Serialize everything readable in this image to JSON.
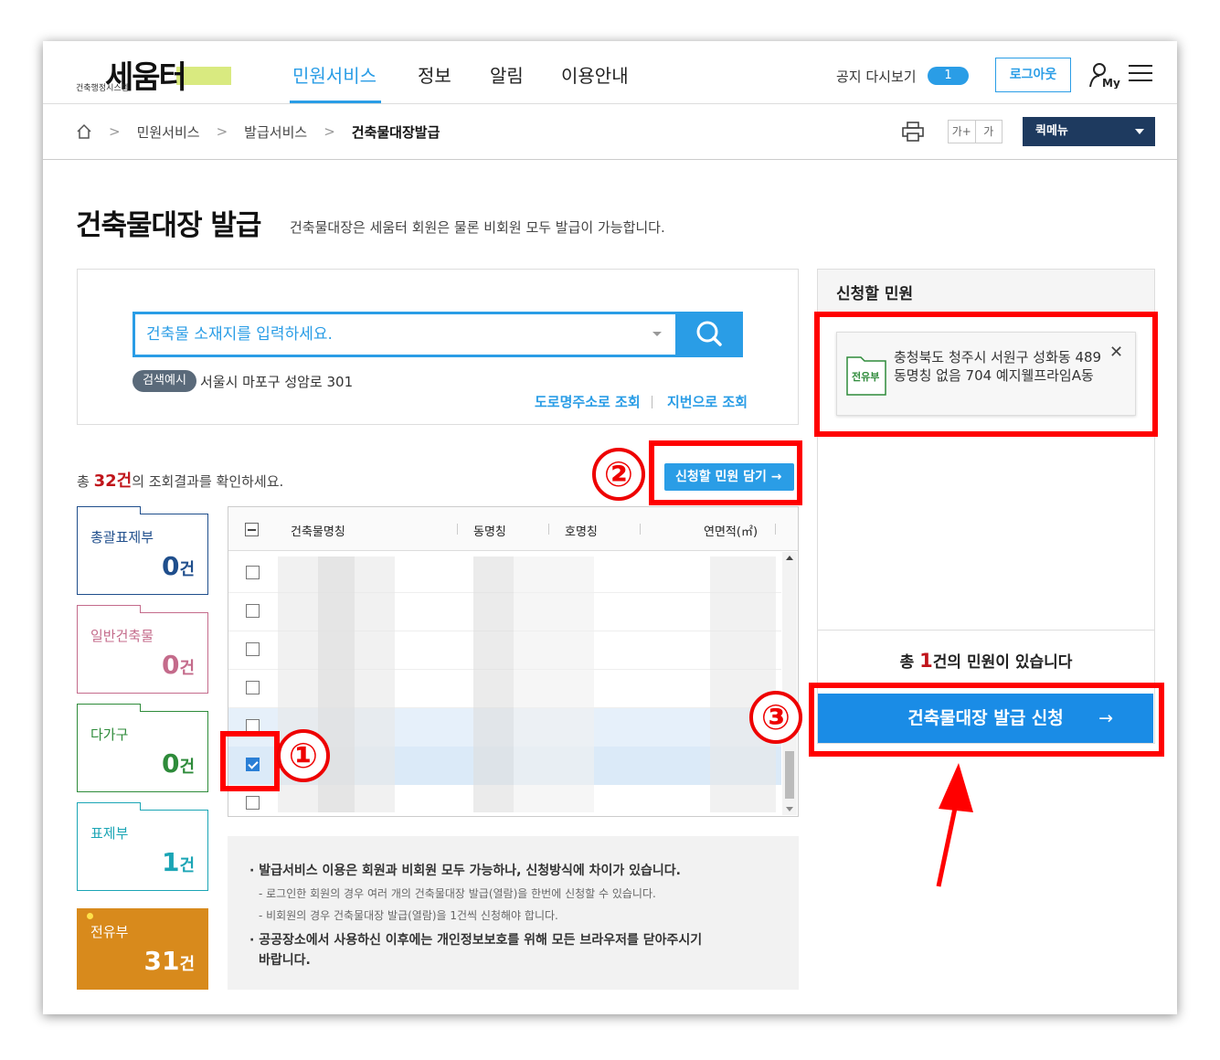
{
  "header": {
    "logo_main": "세움터",
    "logo_sub": "건축행정시스템",
    "nav": [
      "민원서비스",
      "정보",
      "알림",
      "이용안내"
    ],
    "notice_label": "공지 다시보기",
    "notice_count": "1",
    "logout": "로그아웃"
  },
  "breadcrumb": {
    "items": [
      "민원서비스",
      "발급서비스",
      "건축물대장발급"
    ],
    "sep": ">"
  },
  "font_size": {
    "larger": "가+",
    "smaller": "가"
  },
  "quick_menu": "퀵메뉴",
  "page": {
    "title": "건축물대장 발급",
    "desc": "건축물대장은 세움터 회원은 물론 비회원 모두 발급이 가능합니다."
  },
  "search": {
    "placeholder": "건축물 소재지를 입력하세요.",
    "example_label": "검색예시",
    "example_text": "서울시 마포구 성암로 301",
    "road_link": "도로명주소로 조회",
    "lot_link": "지번으로 조회"
  },
  "results": {
    "prefix": "총 ",
    "count": "32건",
    "suffix": "의 조회결과를 확인하세요.",
    "add_button": "신청할 민원 담기 →"
  },
  "categories": [
    {
      "name": "총괄표제부",
      "count": "0",
      "unit": "건",
      "color": "#1f4e8c"
    },
    {
      "name": "일반건축물",
      "count": "0",
      "unit": "건",
      "color": "#c46b8b"
    },
    {
      "name": "다가구",
      "count": "0",
      "unit": "건",
      "color": "#2e8b3a"
    },
    {
      "name": "표제부",
      "count": "1",
      "unit": "건",
      "color": "#1ba5b5"
    },
    {
      "name": "전유부",
      "count": "31",
      "unit": "건",
      "color": "#d88a1c"
    }
  ],
  "table": {
    "headers": [
      "건축물명칭",
      "동명칭",
      "호명칭",
      "연면적(㎡)"
    ]
  },
  "notes": {
    "n1": "· 발급서비스 이용은 회원과 비회원 모두 가능하나, 신청방식에 차이가 있습니다.",
    "n1a": "- 로그인한 회원의 경우 여러 개의 건축물대장 발급(열람)을 한번에 신청할 수 있습니다.",
    "n1b": "- 비회원의 경우 건축물대장 발급(열람)을 1건씩 신청해야 합니다.",
    "n2a": "· 공공장소에서 사용하신 이후에는 개인정보보호를 위해 모든 브라우저를 닫아주시기",
    "n2b": "바랍니다."
  },
  "cart": {
    "title": "신청할 민원",
    "item_type": "전유부",
    "item_address": "충청북도 청주시 서원구 성화동 489 동명칭 없음 704 예지웰프라임A동",
    "total_prefix": "총 ",
    "total_count": "1",
    "total_suffix": "건의 민원이 있습니다",
    "apply_button": "건축물대장 발급 신청",
    "apply_arrow": "→"
  },
  "annotations": {
    "step1": "①",
    "step2": "②",
    "step3": "③",
    "highlight_color": "#ff0000"
  }
}
